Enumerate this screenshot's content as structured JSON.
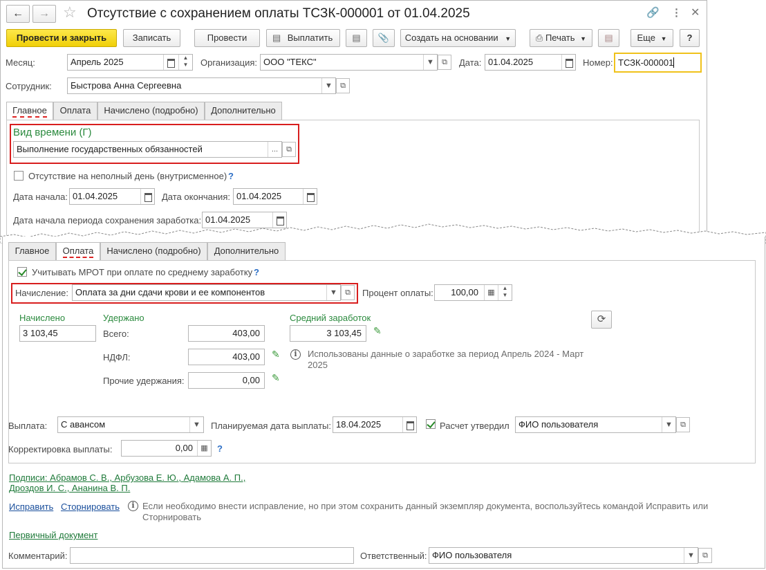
{
  "window": {
    "title": "Отсутствие с сохранением оплаты ТСЗК-000001 от 01.04.2025"
  },
  "toolbar": {
    "post_close": "Провести и закрыть",
    "save": "Записать",
    "post": "Провести",
    "pay": "Выплатить",
    "create_based": "Создать на основании",
    "print": "Печать",
    "more": "Еще",
    "help": "?"
  },
  "header": {
    "month_label": "Месяц:",
    "month_value": "Апрель 2025",
    "org_label": "Организация:",
    "org_value": "ООО \"ТЕКС\"",
    "date_label": "Дата:",
    "date_value": "01.04.2025",
    "number_label": "Номер:",
    "number_value": "ТСЗК-000001",
    "employee_label": "Сотрудник:",
    "employee_value": "Быстрова Анна Сергеевна"
  },
  "tabs": [
    "Главное",
    "Оплата",
    "Начислено (подробно)",
    "Дополнительно"
  ],
  "main_tab": {
    "time_type_label": "Вид времени (Г)",
    "time_type_value": "Выполнение государственных обязанностей",
    "partial_day_label": "Отсутствие на неполный день (внутрисменное)",
    "start_label": "Дата начала:",
    "start_value": "01.04.2025",
    "end_label": "Дата окончания:",
    "end_value": "01.04.2025",
    "earn_start_label": "Дата начала периода сохранения заработка:",
    "earn_start_value": "01.04.2025"
  },
  "pay_tab": {
    "mrot_label": "Учитывать МРОТ при оплате по среднему заработку",
    "accrual_label": "Начисление:",
    "accrual_value": "Оплата за дни сдачи крови и ее компонентов",
    "percent_label": "Процент оплаты:",
    "percent_value": "100,00",
    "accrued_header": "Начислено",
    "accrued_value": "3 103,45",
    "withheld_header": "Удержано",
    "total_label": "Всего:",
    "total_value": "403,00",
    "ndfl_label": "НДФЛ:",
    "ndfl_value": "403,00",
    "other_label": "Прочие удержания:",
    "other_value": "0,00",
    "avg_header": "Средний заработок",
    "avg_value": "3 103,45",
    "avg_note": "Использованы данные о заработке за период Апрель 2024 - Март 2025",
    "payout_label": "Выплата:",
    "payout_value": "С авансом",
    "plan_date_label": "Планируемая дата выплаты:",
    "plan_date_value": "18.04.2025",
    "approved_label": "Расчет утвердил",
    "approved_value": "ФИО пользователя",
    "correction_label": "Корректировка выплаты:",
    "correction_value": "0,00"
  },
  "footer": {
    "signatures": "Подписи: Абрамов С. В., Арбузова Е. Ю., Адамова А. П.,",
    "signatures2": "Дроздов И. С., Ананина В. П.",
    "fix": "Исправить",
    "reverse": "Сторнировать",
    "fix_note": "Если необходимо внести исправление, но при этом сохранить данный экземпляр документа, воспользуйтесь командой Исправить или Сторнировать",
    "primary_doc": "Первичный документ",
    "comment_label": "Комментарий:",
    "comment_value": "",
    "responsible_label": "Ответственный:",
    "responsible_value": "ФИО пользователя"
  },
  "colors": {
    "primary_button": "#f0cf08",
    "highlight": "#d81e1e",
    "green_text": "#2b8a3e",
    "focus": "#f0c21a"
  },
  "icons": [
    "back-arrow-icon",
    "forward-arrow-icon",
    "star-icon",
    "link-icon",
    "kebab-menu-icon",
    "close-icon",
    "calendar-icon",
    "dropdown-icon",
    "open-icon",
    "pencil-icon",
    "info-icon",
    "refresh-icon",
    "print-icon",
    "paperclip-icon",
    "report-icon"
  ]
}
